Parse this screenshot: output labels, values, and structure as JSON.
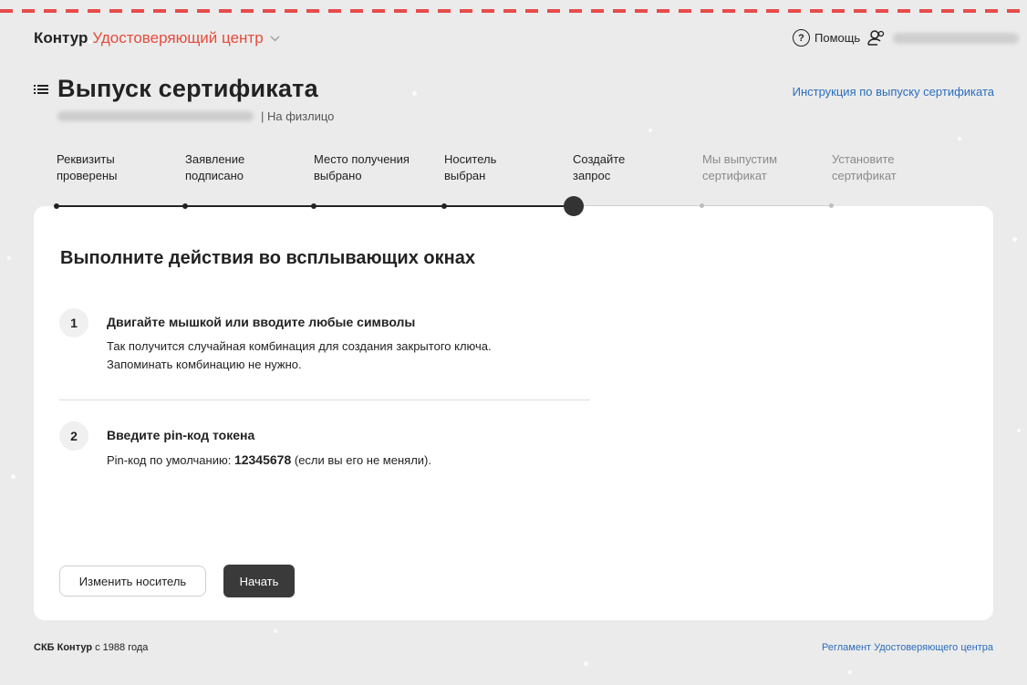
{
  "header": {
    "brand": "Контур",
    "product": "Удостоверяющий центр",
    "help_label": "Помощь"
  },
  "page": {
    "title": "Выпуск сертификата",
    "subtitle_suffix": "| На физлицо",
    "instructions_link": "Инструкция по выпуску сертификата"
  },
  "stepper": {
    "steps": [
      {
        "line1": "Реквизиты",
        "line2": "проверены",
        "state": "done"
      },
      {
        "line1": "Заявление",
        "line2": "подписано",
        "state": "done"
      },
      {
        "line1": "Место получения",
        "line2": "выбрано",
        "state": "done"
      },
      {
        "line1": "Носитель",
        "line2": "выбран",
        "state": "done"
      },
      {
        "line1": "Создайте",
        "line2": "запрос",
        "state": "current"
      },
      {
        "line1": "Мы выпустим",
        "line2": "сертификат",
        "state": "future"
      },
      {
        "line1": "Установите",
        "line2": "сертификат",
        "state": "future"
      }
    ]
  },
  "card": {
    "heading": "Выполните действия во всплывающих окнах",
    "items": [
      {
        "number": "1",
        "title": "Двигайте мышкой или вводите любые символы",
        "line1": "Так получится случайная комбинация для создания закрытого ключа.",
        "line2": "Запоминать комбинацию не нужно."
      },
      {
        "number": "2",
        "title": "Введите pin-код токена",
        "prefix": "Pin-код по умолчанию:",
        "pin": "12345678",
        "suffix": "(если вы его не меняли)."
      }
    ],
    "change_button": "Изменить носитель",
    "start_button": "Начать"
  },
  "footer": {
    "company": "СКБ Контур",
    "since": "с 1988 года",
    "regulation_link": "Регламент Удостоверяющего центра"
  },
  "colors": {
    "accent": "#e84b3c",
    "link": "#2a6ebd",
    "primary_button": "#3a3a3a"
  }
}
